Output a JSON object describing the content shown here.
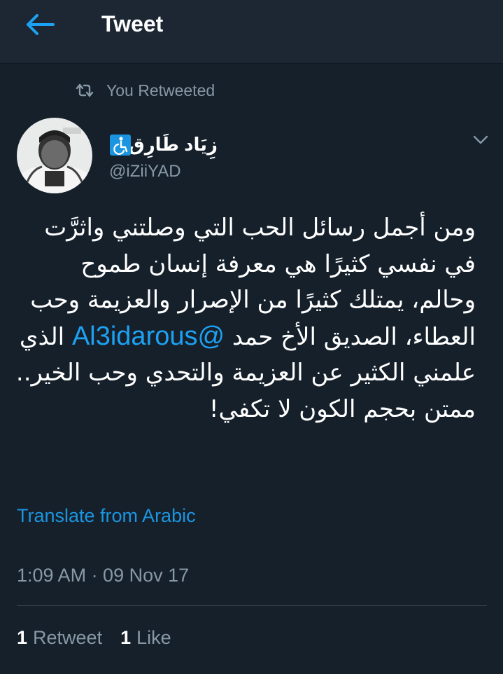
{
  "colors": {
    "background": "#15202b",
    "header": "#1c2733",
    "accent": "#1b95e0",
    "secondary_text": "#8899a6"
  },
  "header": {
    "title": "Tweet",
    "back_icon": "arrow-left-icon"
  },
  "retweet_context": {
    "icon": "retweet-icon",
    "label": "You Retweeted"
  },
  "author": {
    "name": "زِيَاد طَارِق.",
    "badge_icon": "wheelchair-accessibility-icon",
    "handle": "@iZiiYAD"
  },
  "tweet": {
    "text_before_mention": "ومن أجمل رسائل الحب التي وصلتني واثرَّت في نفسي كثيرًا هي معرفة إنسان طموح وحالم، يمتلك كثيرًا من الإصرار والعزيمة وحب العطاء، الصديق الأخ حمد",
    "mention": "@Al3idarous",
    "text_after_mention": "الذي علمني الكثير عن العزيمة والتحدي وحب الخير.. ممتن بحجم الكون لا تكفي!",
    "translate_label": "Translate from Arabic",
    "timestamp": "1:09 AM · 09 Nov 17"
  },
  "stats": {
    "retweets_count": "1",
    "retweets_label": "Retweet",
    "likes_count": "1",
    "likes_label": "Like"
  },
  "menu_icon": "chevron-down-icon"
}
